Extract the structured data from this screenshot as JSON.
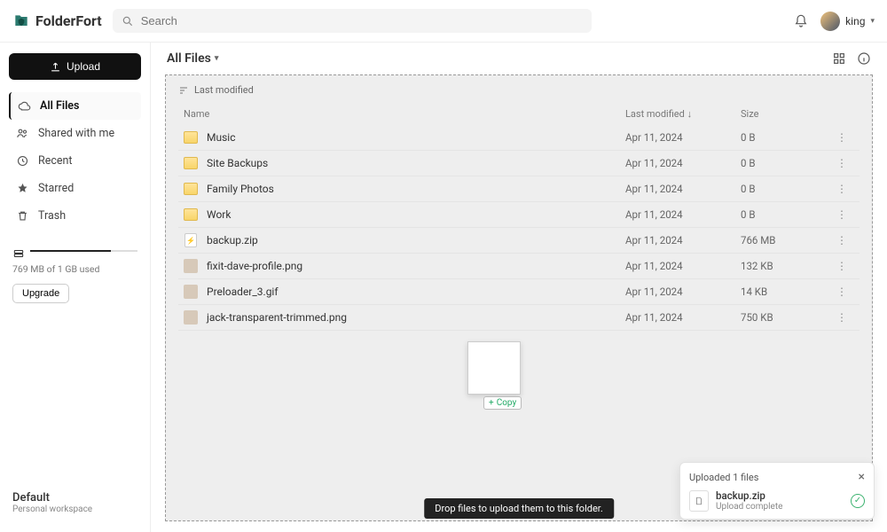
{
  "brand": "FolderFort",
  "search": {
    "placeholder": "Search"
  },
  "user": {
    "name": "king"
  },
  "upload_label": "Upload",
  "nav": {
    "all_files": "All Files",
    "shared": "Shared with me",
    "recent": "Recent",
    "starred": "Starred",
    "trash": "Trash"
  },
  "storage": {
    "text": "769 MB of 1 GB used",
    "upgrade": "Upgrade"
  },
  "workspace": {
    "name": "Default",
    "sub": "Personal workspace"
  },
  "breadcrumb": "All Files",
  "sort_label": "Last modified",
  "columns": {
    "name": "Name",
    "modified": "Last modified",
    "size": "Size"
  },
  "rows": [
    {
      "type": "folder",
      "name": "Music",
      "modified": "Apr 11, 2024",
      "size": "0 B"
    },
    {
      "type": "folder",
      "name": "Site Backups",
      "modified": "Apr 11, 2024",
      "size": "0 B"
    },
    {
      "type": "folder",
      "name": "Family Photos",
      "modified": "Apr 11, 2024",
      "size": "0 B"
    },
    {
      "type": "folder",
      "name": "Work",
      "modified": "Apr 11, 2024",
      "size": "0 B"
    },
    {
      "type": "file",
      "name": "backup.zip",
      "modified": "Apr 11, 2024",
      "size": "766 MB"
    },
    {
      "type": "image",
      "name": "fixit-dave-profile.png",
      "modified": "Apr 11, 2024",
      "size": "132 KB"
    },
    {
      "type": "image",
      "name": "Preloader_3.gif",
      "modified": "Apr 11, 2024",
      "size": "14 KB"
    },
    {
      "type": "image",
      "name": "jack-transparent-trimmed.png",
      "modified": "Apr 11, 2024",
      "size": "750 KB"
    }
  ],
  "copy_badge": "Copy",
  "drop_hint": "Drop files to upload them to this folder.",
  "toast": {
    "title": "Uploaded 1 files",
    "file": "backup.zip",
    "status": "Upload complete"
  }
}
